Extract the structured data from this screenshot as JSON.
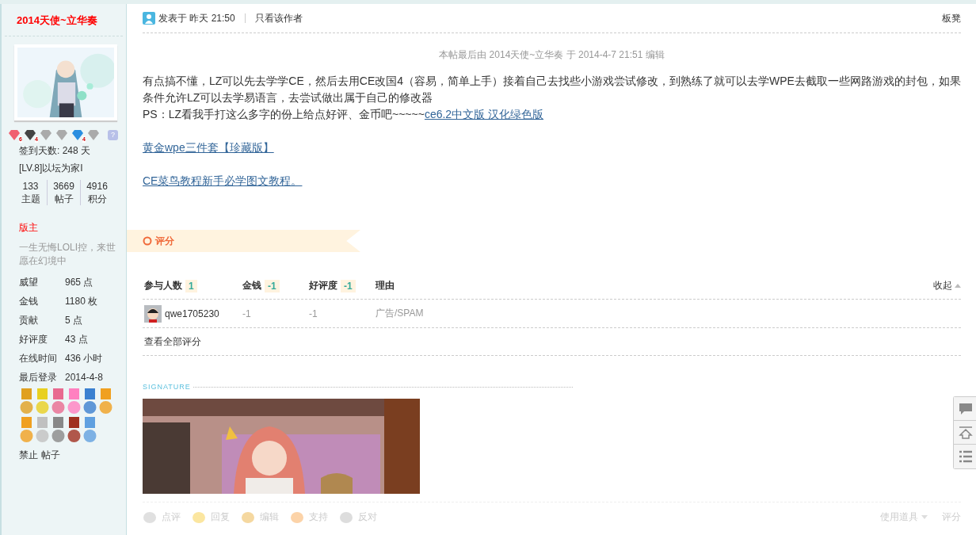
{
  "author": {
    "name": "2014天使~立华奏",
    "badges": [
      {
        "color": "#f06070",
        "count": "6"
      },
      {
        "color": "#444444",
        "count": "4"
      },
      {
        "color": "#aaaaaa"
      },
      {
        "color": "#aaaaaa"
      },
      {
        "color": "#2a8ee0",
        "count": "4"
      },
      {
        "color": "#aaaaaa"
      }
    ],
    "help": "?",
    "checkin": "签到天数: 248 天",
    "level": "[LV.8]以坛为家I",
    "stats": [
      {
        "value": "133",
        "label": "主题"
      },
      {
        "value": "3669",
        "label": "帖子"
      },
      {
        "value": "4916",
        "label": "积分"
      }
    ],
    "role": "版主",
    "motto": "一生无悔LOLI控，来世愿在幻境中",
    "profile": [
      {
        "label": "威望",
        "value": "965 点"
      },
      {
        "label": "金钱",
        "value": "1180 枚"
      },
      {
        "label": "贡献",
        "value": "5 点"
      },
      {
        "label": "好评度",
        "value": "43 点"
      },
      {
        "label": "在线时间",
        "value": "436 小时"
      },
      {
        "label": "最后登录",
        "value": "2014-4-8"
      }
    ],
    "actions": [
      "禁止",
      "帖子"
    ]
  },
  "post": {
    "posted": "发表于 昨天 21:50",
    "author_only": "只看该作者",
    "floor": "板凳",
    "edit_note": "本帖最后由 2014天使~立华奏 于 2014-4-7 21:51 编辑",
    "paragraph": "有点搞不懂，LZ可以先去学学CE，然后去用CE改国4（容易，简单上手）接着自己去找些小游戏尝试修改，到熟练了就可以去学WPE去截取一些网路游戏的封包，如果条件允许LZ可以去学易语言，去尝试做出属于自己的修改器",
    "ps": "PS：LZ看我手打这么多字的份上给点好评、金币吧~~~~~",
    "ps_link": "ce6.2中文版 汉化绿色版",
    "links": [
      "黄金wpe三件套【珍藏版】",
      "CE菜鸟教程新手必学图文教程。"
    ]
  },
  "rating": {
    "title": "评分",
    "columns": [
      {
        "label": "参与人数",
        "count": "1"
      },
      {
        "label": "金钱",
        "count": "-1"
      },
      {
        "label": "好评度",
        "count": "-1"
      },
      {
        "label": "理由"
      }
    ],
    "collapse": "收起",
    "rows": [
      {
        "user": "qwe1705230",
        "money": "-1",
        "score": "-1",
        "reason": "广告/SPAM"
      }
    ],
    "view_all": "查看全部评分"
  },
  "signature": {
    "label": "SIGNATURE"
  },
  "footer": {
    "actions": [
      "点评",
      "回复",
      "编辑",
      "支持",
      "反对"
    ],
    "tools": "使用道具",
    "rate": "评分"
  }
}
